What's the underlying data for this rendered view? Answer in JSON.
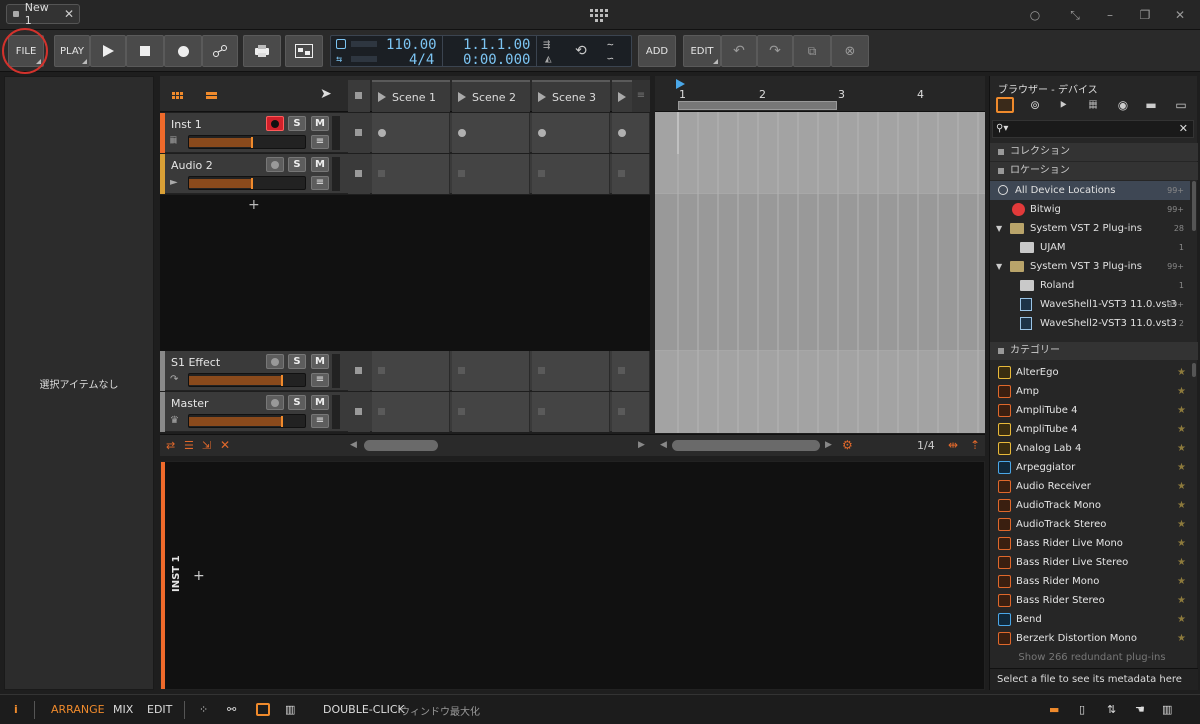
{
  "titlebar": {
    "tab_label": "New 1",
    "tab_close": "✕"
  },
  "toolbar": {
    "file_label": "FILE",
    "play_label": "PLAY",
    "tempo": "110.00",
    "signature": "4/4",
    "position_bars": "1.1.1.00",
    "position_time": "0:00.000",
    "add_label": "ADD",
    "edit_label": "EDIT"
  },
  "left_panel": {
    "empty_text": "選択アイテムなし"
  },
  "scenes": [
    "Scene 1",
    "Scene 2",
    "Scene 3"
  ],
  "tracks": [
    {
      "name": "Inst 1",
      "color": "#ef6a2b",
      "volume": 0.55,
      "rec_armed": true
    },
    {
      "name": "Audio 2",
      "color": "#d9a036",
      "volume": 0.55,
      "rec_armed": false
    },
    {
      "name": "S1 Effect",
      "color": "#8a8a8a",
      "volume": 0.8,
      "rec_armed": false
    },
    {
      "name": "Master",
      "color": "#8a8a8a",
      "volume": 0.8,
      "rec_armed": false
    }
  ],
  "add_track_symbol": "+",
  "ruler": {
    "bars": [
      "1",
      "2",
      "3",
      "4"
    ]
  },
  "scroll": {
    "zoom_label": "1/4"
  },
  "detail": {
    "track_label": "INST 1",
    "add_symbol": "+"
  },
  "browser": {
    "title": "ブラウザー - デバイス",
    "sections": {
      "collections": "コレクション",
      "locations": "ロケーション",
      "categories": "カテゴリー"
    },
    "locations": [
      {
        "label": "All Device Locations",
        "count": "99+"
      },
      {
        "label": "Bitwig",
        "count": "99+"
      },
      {
        "label": "System VST 2 Plug-ins",
        "count": "28"
      },
      {
        "label": "UJAM",
        "count": "1"
      },
      {
        "label": "System VST 3 Plug-ins",
        "count": "99+"
      },
      {
        "label": "Roland",
        "count": "1"
      },
      {
        "label": "WaveShell1-VST3 11.0.vst3",
        "count": "99+"
      },
      {
        "label": "WaveShell2-VST3 11.0.vst3",
        "count": "2"
      }
    ],
    "categories": [
      {
        "label": "AlterEgo",
        "kind": "yellow"
      },
      {
        "label": "Amp",
        "kind": "orange"
      },
      {
        "label": "AmpliTube 4",
        "kind": "orange"
      },
      {
        "label": "AmpliTube 4",
        "kind": "yellow"
      },
      {
        "label": "Analog Lab 4",
        "kind": "yellow"
      },
      {
        "label": "Arpeggiator",
        "kind": "blue"
      },
      {
        "label": "Audio Receiver",
        "kind": "orange"
      },
      {
        "label": "AudioTrack Mono",
        "kind": "orange"
      },
      {
        "label": "AudioTrack Stereo",
        "kind": "orange"
      },
      {
        "label": "Bass Rider Live Mono",
        "kind": "orange"
      },
      {
        "label": "Bass Rider Live Stereo",
        "kind": "orange"
      },
      {
        "label": "Bass Rider Mono",
        "kind": "orange"
      },
      {
        "label": "Bass Rider Stereo",
        "kind": "orange"
      },
      {
        "label": "Bend",
        "kind": "blue"
      },
      {
        "label": "Berzerk Distortion Mono",
        "kind": "orange"
      }
    ],
    "redundant_note": "Show 266 redundant plug-ins",
    "metadata_note": "Select a file to see its metadata here"
  },
  "statusbar": {
    "arrange": "ARRANGE",
    "mix": "MIX",
    "edit": "EDIT",
    "hint_key": "DOUBLE-CLICK",
    "hint_text": "ウィンドウ最大化"
  },
  "accent_color": "#ef6a2b"
}
